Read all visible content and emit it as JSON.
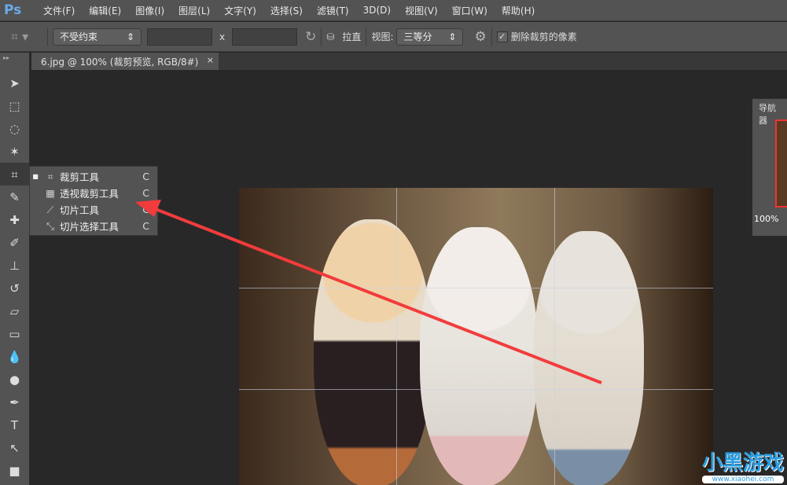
{
  "app": {
    "logo": "Ps"
  },
  "menu": [
    "文件(F)",
    "编辑(E)",
    "图像(I)",
    "图层(L)",
    "文字(Y)",
    "选择(S)",
    "滤镜(T)",
    "3D(D)",
    "视图(V)",
    "窗口(W)",
    "帮助(H)"
  ],
  "options": {
    "ratio": "不受约束",
    "x_sep": "x",
    "straighten": "拉直",
    "view_label": "视图:",
    "view_value": "三等分",
    "delete_pixels": "删除裁剪的像素",
    "delete_checked": true
  },
  "document_tab": {
    "title": "6.jpg @ 100% (裁剪预览, RGB/8#)",
    "close": "×"
  },
  "flyout": [
    {
      "label": "裁剪工具",
      "key": "C",
      "active": true
    },
    {
      "label": "透视裁剪工具",
      "key": "C"
    },
    {
      "label": "切片工具",
      "key": "C"
    },
    {
      "label": "切片选择工具",
      "key": "C"
    }
  ],
  "navigator": {
    "title": "导航器",
    "zoom": "100%"
  },
  "watermark": {
    "text": "小黑游戏",
    "url": "www.xiaohei.com"
  },
  "colors": {
    "arrow": "#f23c3c",
    "accent": "#6aa9e6"
  }
}
